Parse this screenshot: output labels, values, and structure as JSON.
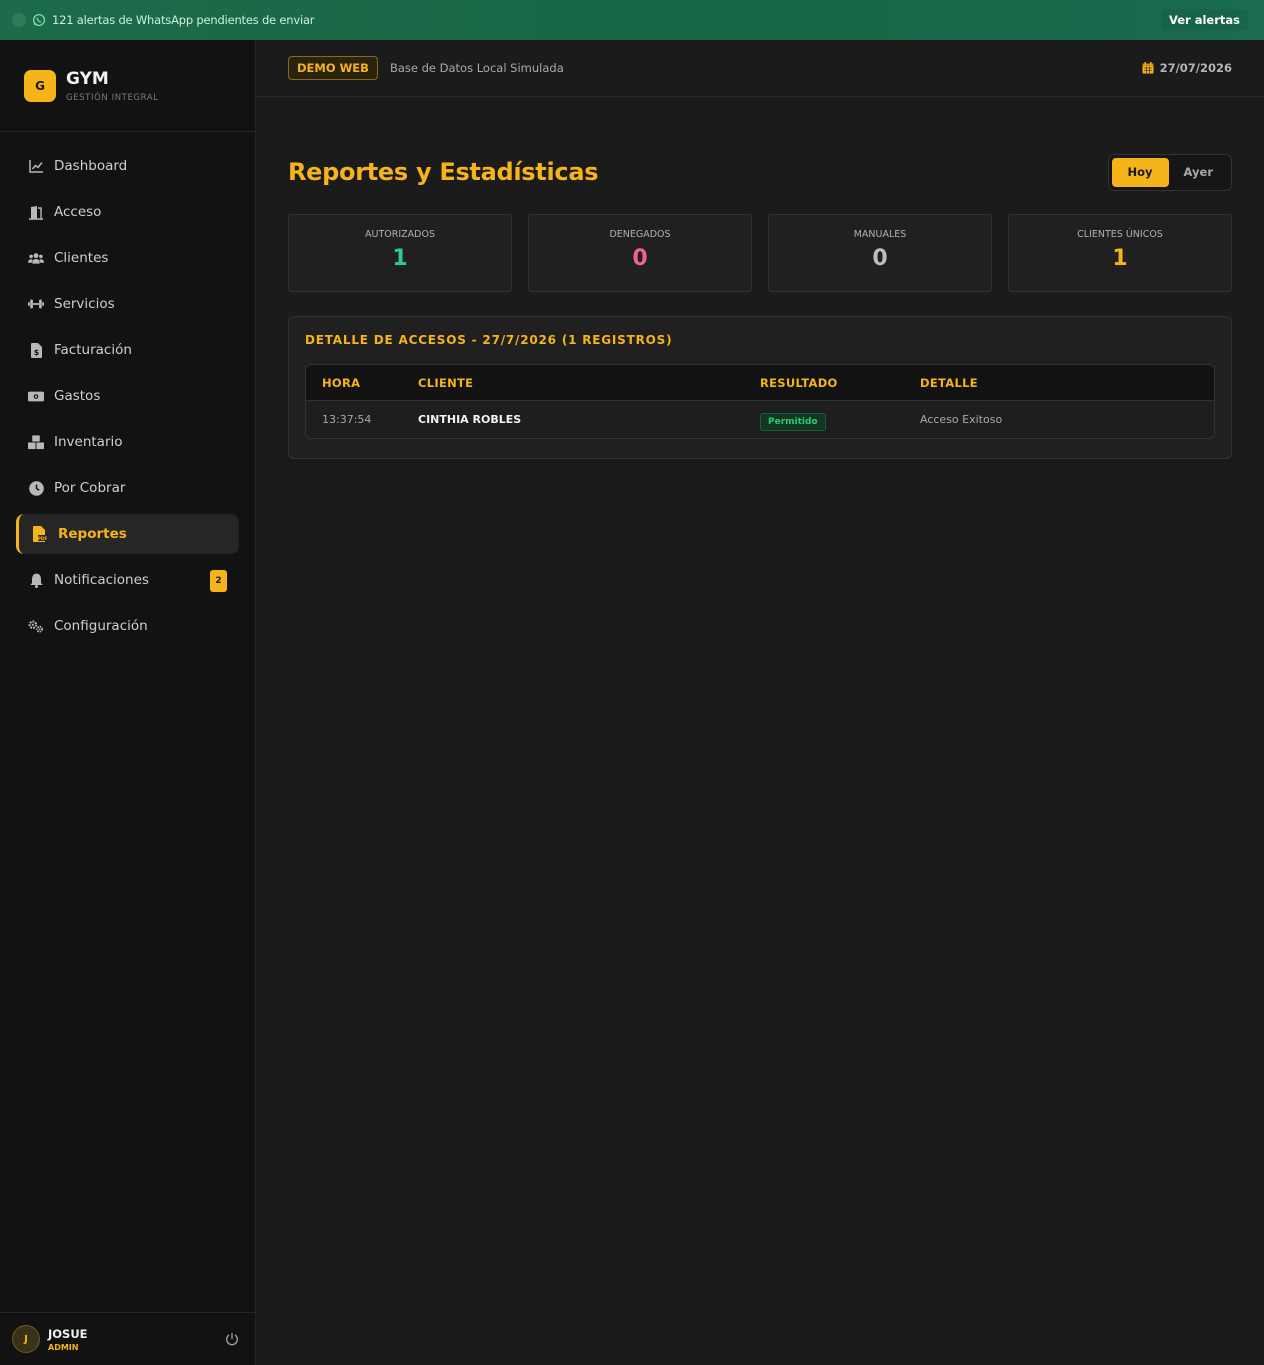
{
  "banner": {
    "message": "121 alertas de WhatsApp pendientes de enviar",
    "action_label": "Ver alertas",
    "icon": "whatsapp-icon"
  },
  "brand": {
    "logo_letter": "G",
    "name": "GYM",
    "subtitle": "GESTIÓN INTEGRAL"
  },
  "sidebar": {
    "items": [
      {
        "label": "Dashboard",
        "icon": "chart-line-icon"
      },
      {
        "label": "Acceso",
        "icon": "door-icon"
      },
      {
        "label": "Clientes",
        "icon": "users-icon"
      },
      {
        "label": "Servicios",
        "icon": "dumbbell-icon"
      },
      {
        "label": "Facturación",
        "icon": "invoice-icon"
      },
      {
        "label": "Gastos",
        "icon": "money-icon"
      },
      {
        "label": "Inventario",
        "icon": "boxes-icon"
      },
      {
        "label": "Por Cobrar",
        "icon": "clock-icon"
      },
      {
        "label": "Reportes",
        "icon": "pdf-file-icon",
        "active": true
      },
      {
        "label": "Notificaciones",
        "icon": "bell-icon",
        "badge": "2"
      },
      {
        "label": "Configuración",
        "icon": "gears-icon"
      }
    ]
  },
  "user": {
    "initial": "J",
    "name": "JOSUE",
    "role": "ADMIN"
  },
  "header": {
    "demo_tag": "DEMO WEB",
    "db_label": "Base de Datos Local Simulada",
    "date": "27/07/2026"
  },
  "page": {
    "title": "Reportes y Estadísticas",
    "range_options": [
      "Hoy",
      "Ayer"
    ],
    "range_selected": "Hoy"
  },
  "stats": [
    {
      "label": "AUTORIZADOS",
      "value": "1",
      "color": "#2ecc8f"
    },
    {
      "label": "DENEGADOS",
      "value": "0",
      "color": "#f06292"
    },
    {
      "label": "MANUALES",
      "value": "0",
      "color": "#bdbdbd"
    },
    {
      "label": "CLIENTES ÚNICOS",
      "value": "1",
      "color": "#f4b41a"
    }
  ],
  "detail": {
    "title": "DETALLE DE ACCESOS - 27/7/2026 (1 REGISTROS)",
    "columns": [
      "HORA",
      "CLIENTE",
      "RESULTADO",
      "DETALLE"
    ],
    "rows": [
      {
        "time": "13:37:54",
        "client": "CINTHIA ROBLES",
        "result": "Permitido",
        "detail": "Acceso Exitoso"
      }
    ]
  },
  "colors": {
    "accent": "#f4b41a",
    "banner_bg": "#146644",
    "success": "#2ecc71",
    "danger": "#f06292"
  }
}
